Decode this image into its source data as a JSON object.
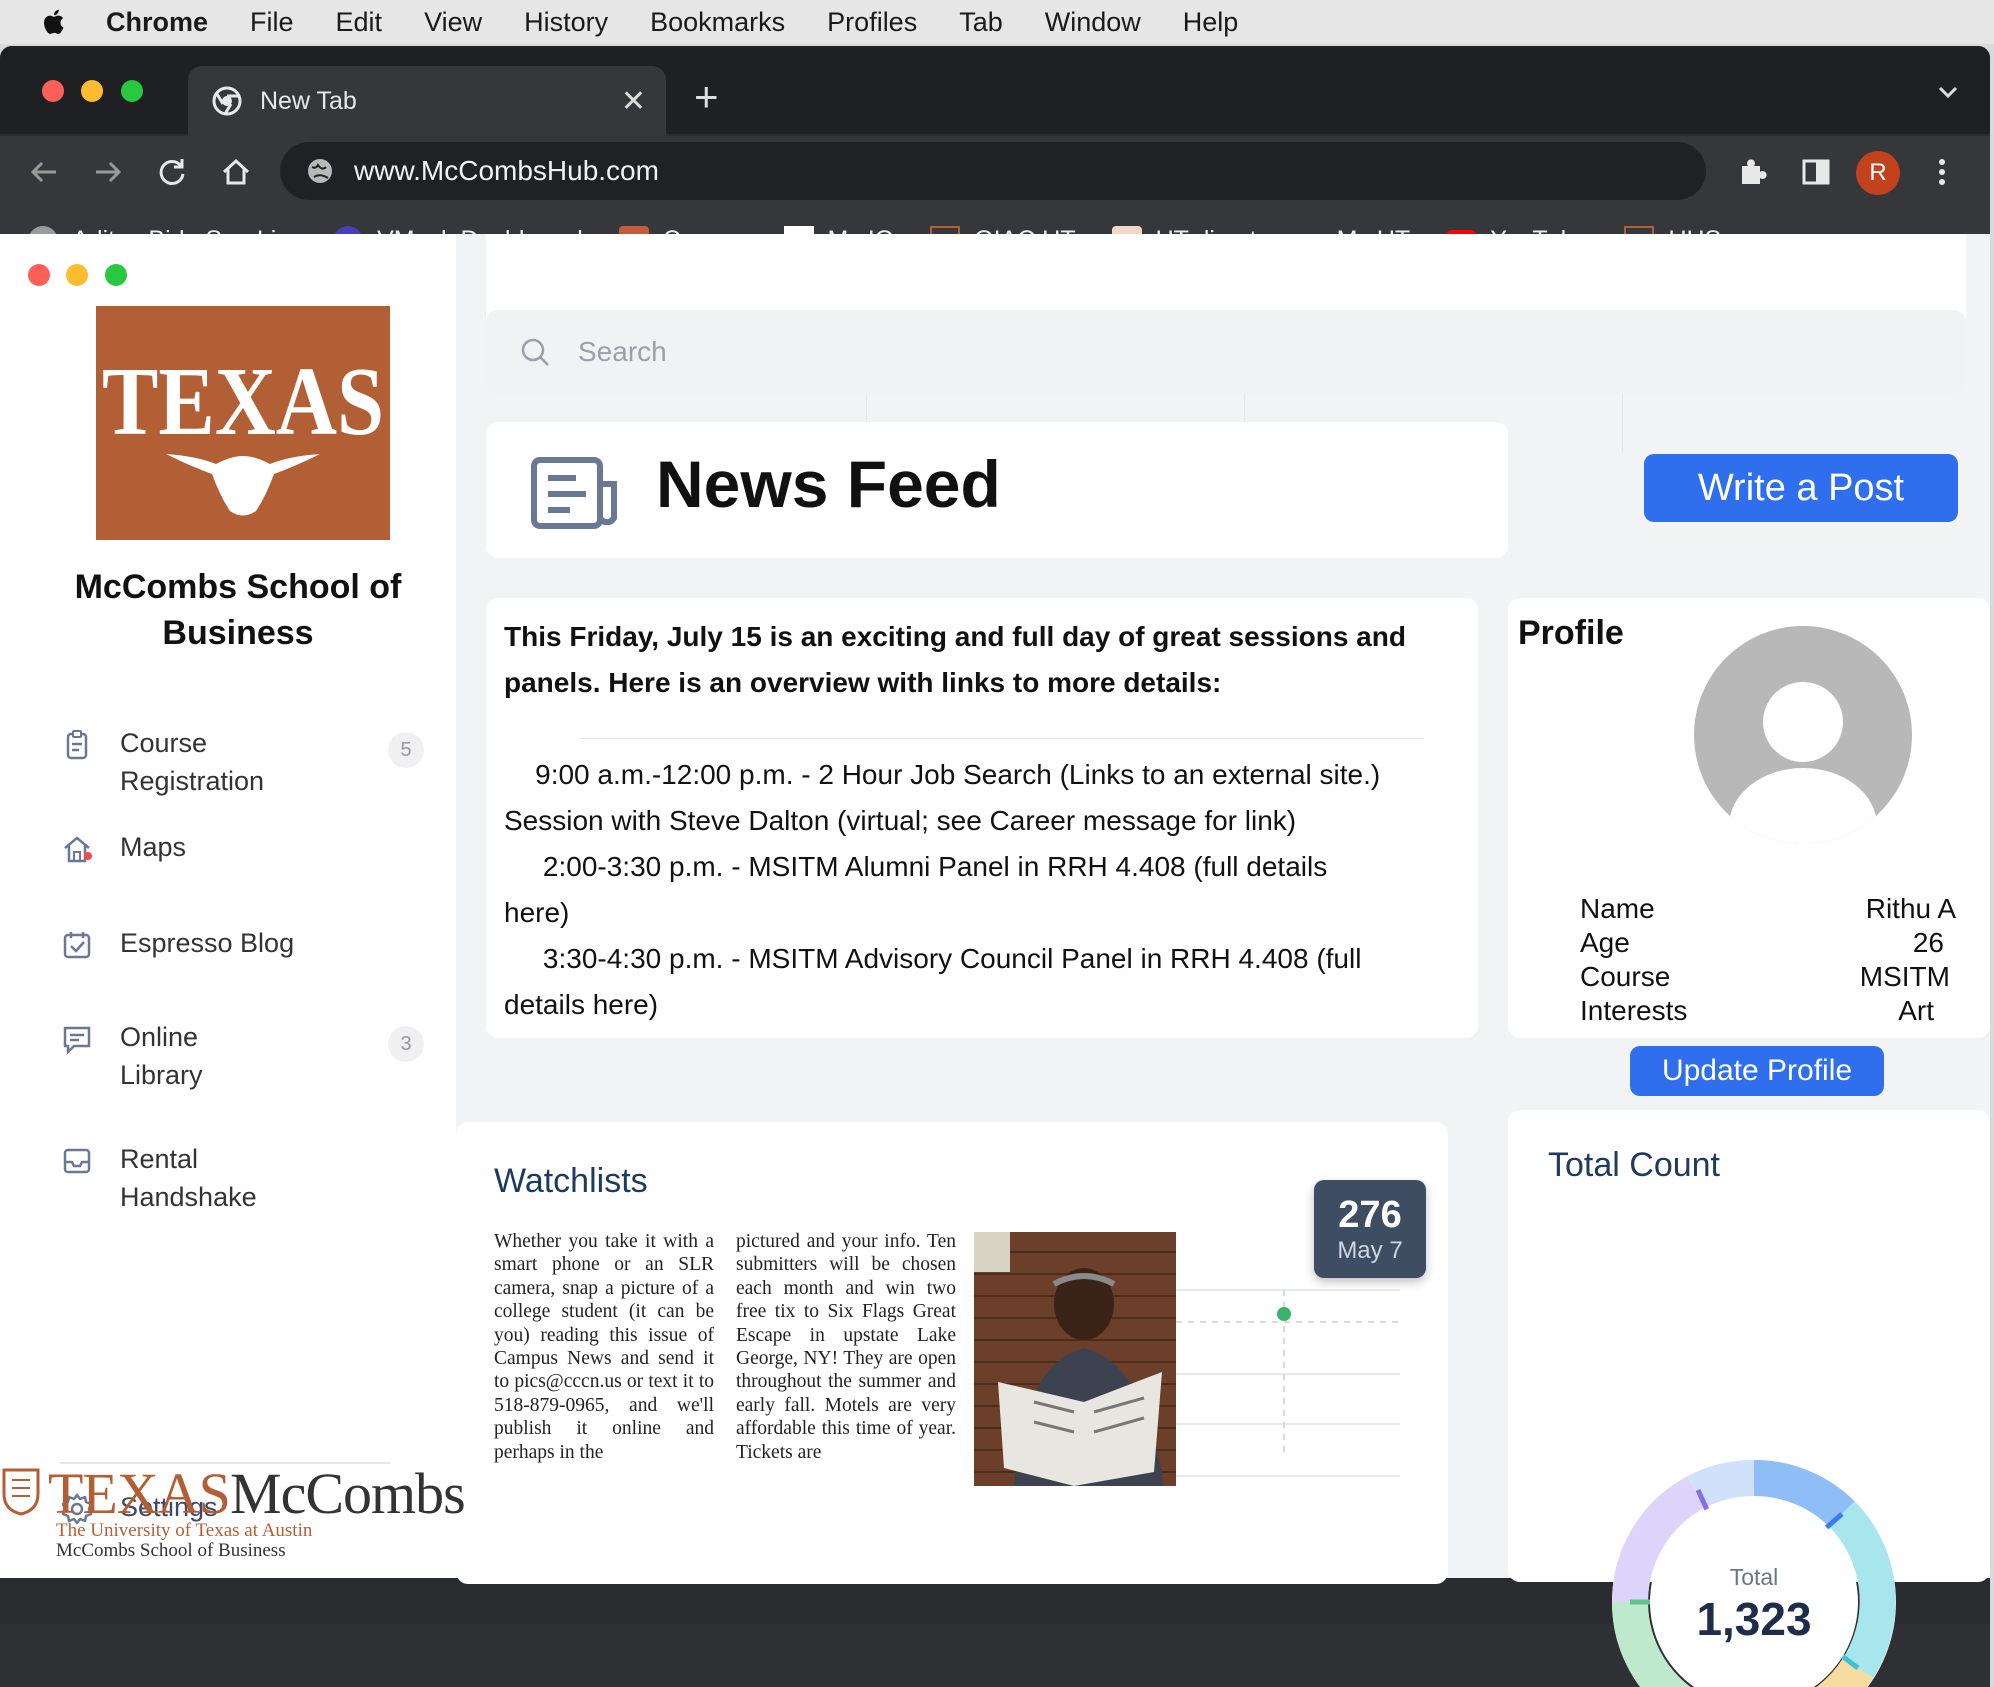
{
  "menubar": {
    "app": "Chrome",
    "items": [
      "File",
      "Edit",
      "View",
      "History",
      "Bookmarks",
      "Profiles",
      "Tab",
      "Window",
      "Help"
    ]
  },
  "browser": {
    "tab_title": "New Tab",
    "url": "www.McCombsHub.com",
    "profile_initial": "R",
    "bookmarks": [
      {
        "label": "Aditya Birla Sun Li...",
        "icon": "globe-icon"
      },
      {
        "label": "VMock Dashboard",
        "icon": "vmock-icon"
      },
      {
        "label": "Canvas",
        "icon": "canvas-icon"
      },
      {
        "label": "My IO",
        "icon": "blank-page-icon"
      },
      {
        "label": "GIAC UT",
        "icon": "ut-shield-icon"
      },
      {
        "label": "UT direct",
        "icon": "ut-tower-icon"
      },
      {
        "label": "My UT",
        "icon": "ut-logo-icon"
      },
      {
        "label": "YouTube",
        "icon": "youtube-icon"
      },
      {
        "label": "UHS",
        "icon": "ut-shield-icon"
      }
    ],
    "bookmarks_more": "»"
  },
  "sidebar": {
    "logo_text": "TEXAS",
    "school_name": "McCombs School of Business",
    "nav": [
      {
        "label": "Course Registration",
        "icon": "clipboard-icon",
        "badge": "5"
      },
      {
        "label": "Maps",
        "icon": "home-icon"
      },
      {
        "label": "Espresso Blog",
        "icon": "calendar-check-icon"
      },
      {
        "label": "Online Library",
        "icon": "message-icon",
        "badge": "3"
      },
      {
        "label": "Rental Handshake",
        "icon": "inbox-icon"
      },
      {
        "label": "Settings",
        "icon": "gear-icon"
      }
    ],
    "footer_brand": {
      "texas": "TEXAS",
      "mccombs": "McCombs",
      "line1": "The University of Texas at Austin",
      "line2": "McCombs School of Business"
    }
  },
  "search": {
    "placeholder": "Search"
  },
  "newsfeed": {
    "title": "News Feed",
    "write_button": "Write a Post"
  },
  "post": {
    "headline": "This Friday, July 15 is an exciting and full day of great sessions and panels. Here is an overview with links to more details:",
    "lines": [
      "    9:00 a.m.-12:00 p.m. - 2 Hour Job Search (Links to an external site.)",
      "Session with Steve Dalton (virtual; see Career message for link)",
      "     2:00-3:30 p.m. - MSITM Alumni Panel in RRH 4.408 (full details",
      "here)",
      "     3:30-4:30 p.m. - MSITM Advisory Council Panel in RRH 4.408 (full",
      "details here)"
    ]
  },
  "profile": {
    "title": "Profile",
    "fields": [
      {
        "key": "Name",
        "value": "Rithu A"
      },
      {
        "key": "Age",
        "value": "26"
      },
      {
        "key": "Course",
        "value": "MSITM"
      },
      {
        "key": "Interests",
        "value": "Art"
      }
    ],
    "update_button": "Update Profile"
  },
  "watchlists": {
    "title": "Watchlists",
    "column1": "Whether you take it with a smart phone or an SLR camera, snap a picture of a college student (it can be you) reading this issue of Campus News and send it to pics@cccn.us or text it to 518-879-0965, and we'll publish it online and perhaps in the",
    "column2": "pictured and your info. Ten submitters will be chosen each month and win two free tix to Six Flags Great Escape in upstate Lake George, NY! They are open throughout the summer and early fall. Motels are very affordable this time of year. Tickets are",
    "tooltip_value": "276",
    "tooltip_date": "May 7"
  },
  "total_count": {
    "title": "Total Count",
    "label": "Total",
    "value": "1,323"
  }
}
